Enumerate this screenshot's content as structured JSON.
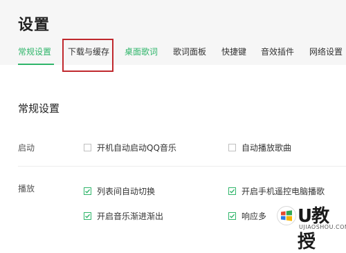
{
  "header": {
    "title": "设置",
    "tabs": [
      {
        "label": "常规设置",
        "state": "active"
      },
      {
        "label": "下载与缓存",
        "state": "highlighted"
      },
      {
        "label": "桌面歌词",
        "state": "green"
      },
      {
        "label": "歌词面板",
        "state": "normal"
      },
      {
        "label": "快捷键",
        "state": "normal"
      },
      {
        "label": "音效插件",
        "state": "normal"
      },
      {
        "label": "网络设置",
        "state": "normal"
      }
    ]
  },
  "section": {
    "title": "常规设置",
    "rows": [
      {
        "label": "启动",
        "options": [
          {
            "label": "开机自动启动QQ音乐",
            "checked": false
          },
          {
            "label": "自动播放歌曲",
            "checked": false
          }
        ]
      },
      {
        "label": "播放",
        "options": [
          {
            "label": "列表间自动切换",
            "checked": true
          },
          {
            "label": "开启手机遥控电脑播歌",
            "checked": true
          },
          {
            "label": "开启音乐渐进渐出",
            "checked": true
          },
          {
            "label": "响应多",
            "checked": true
          }
        ]
      }
    ]
  },
  "watermark": {
    "brand": "U教授",
    "site": "UJIAOSHOU.COM"
  },
  "colors": {
    "accent": "#2fb56a",
    "highlight_box": "#c0282d",
    "header_bg": "#f6f6f6"
  }
}
